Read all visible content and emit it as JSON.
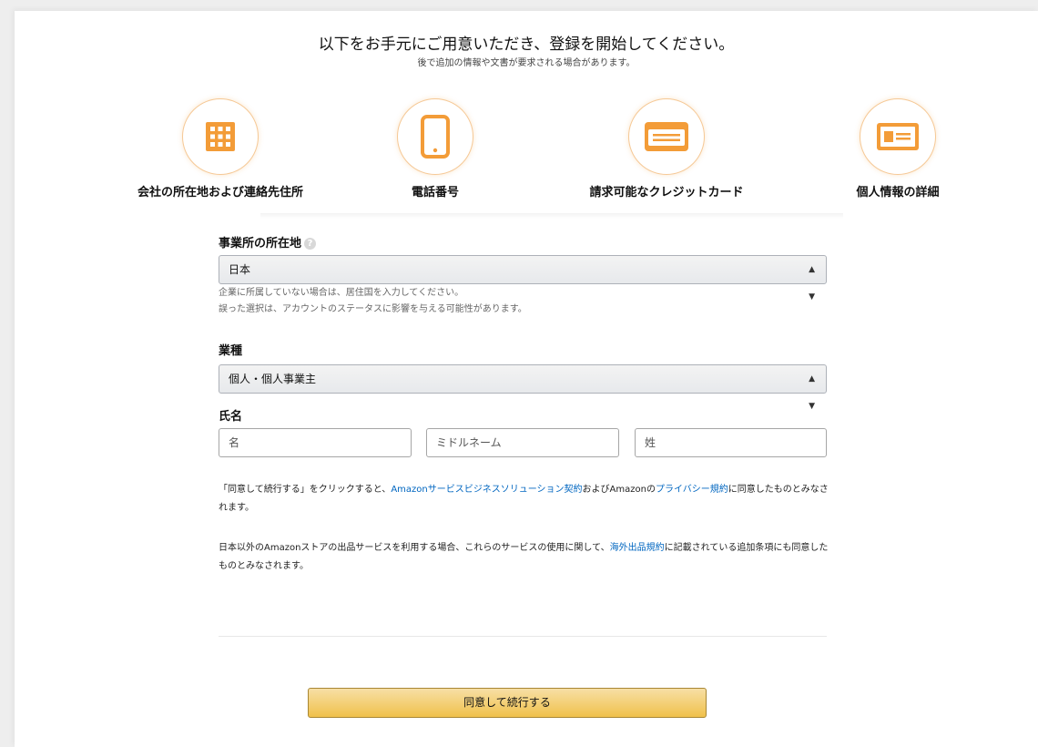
{
  "header": {
    "title": "以下をお手元にご用意いただき、登録を開始してください。",
    "subtitle": "後で追加の情報や文書が要求される場合があります。"
  },
  "requirements": [
    {
      "icon": "building-icon",
      "label": "会社の所在地および連絡先住所"
    },
    {
      "icon": "smartphone-icon",
      "label": "電話番号"
    },
    {
      "icon": "credit-card-icon",
      "label": "請求可能なクレジットカード"
    },
    {
      "icon": "id-card-icon",
      "label": "個人情報の詳細"
    }
  ],
  "form": {
    "location": {
      "label": "事業所の所在地",
      "value": "日本",
      "hint_line1": "企業に所属していない場合は、居住国を入力してください。",
      "hint_line2": "誤った選択は、アカウントのステータスに影響を与える可能性があります。"
    },
    "business_type": {
      "label": "業種",
      "value": "個人・個人事業主"
    },
    "name": {
      "label": "氏名",
      "first_placeholder": "名",
      "middle_placeholder": "ミドルネーム",
      "last_placeholder": "姓"
    }
  },
  "legal": {
    "p1_a": "「同意して続行する」をクリックすると、",
    "p1_link1": "Amazonサービスビジネスソリューション契約",
    "p1_b": "およびAmazonの",
    "p1_link2": "プライバシー規約",
    "p1_c": "に同意したものとみなされます。",
    "p2_a": "日本以外のAmazonストアの出品サービスを利用する場合、これらのサービスの使用に関して、",
    "p2_link": "海外出品規約",
    "p2_b": "に記載されている追加条項にも同意したものとみなされます。"
  },
  "submit_label": "同意して続行する",
  "colors": {
    "accent_orange": "#f39c38",
    "link_blue": "#0066c0",
    "button_gold": "#f0c14b"
  }
}
